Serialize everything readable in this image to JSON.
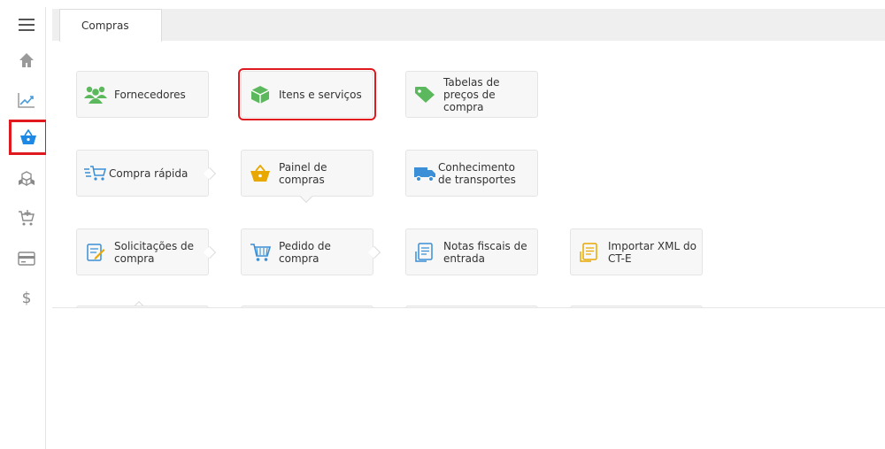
{
  "tabs": [
    {
      "label": "Compras"
    }
  ],
  "rail": [
    {
      "icon": "menu-icon"
    },
    {
      "icon": "home-icon"
    },
    {
      "icon": "chart-icon"
    },
    {
      "icon": "basket-icon",
      "active": true
    },
    {
      "icon": "boxes-icon"
    },
    {
      "icon": "cart-add-icon"
    },
    {
      "icon": "card-icon"
    },
    {
      "icon": "dollar-icon"
    }
  ],
  "tiles": {
    "fornecedores": "Fornecedores",
    "itens": "Itens e serviços",
    "tabelas": "Tabelas de preços de compra",
    "compra_rapida": "Compra rápida",
    "painel": "Painel de compras",
    "conhecimento": "Conhecimento de transportes",
    "solicitacoes": "Solicitações de compra",
    "pedido": "Pedido de compra",
    "notas": "Notas fiscais de entrada",
    "importar": "Importar XML do CT-E"
  },
  "colors": {
    "accent": "#1e88e5",
    "highlight": "#e0191f",
    "green": "#5cb85c",
    "yellow": "#e8a800",
    "blue": "#3a8fd6"
  }
}
